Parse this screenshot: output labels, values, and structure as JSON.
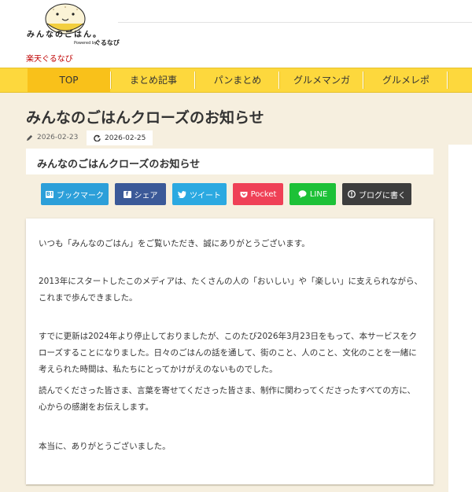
{
  "header": {
    "logo_text": "みんなのごはん。",
    "logo_powered": "Powered by",
    "logo_gnavi": "ぐるなび",
    "rakuten_link": "楽天ぐるなび"
  },
  "nav": {
    "items": [
      {
        "label": "TOP",
        "active": true
      },
      {
        "label": "まとめ記事"
      },
      {
        "label": "パンまとめ"
      },
      {
        "label": "グルメマンガ"
      },
      {
        "label": "グルメレポ"
      }
    ]
  },
  "article": {
    "title": "みんなのごはんクローズのお知らせ",
    "published_date": "2026-02-23",
    "updated_date": "2026-02-25",
    "subtitle": "みんなのごはんクローズのお知らせ",
    "paragraphs": [
      "いつも「みんなのごはん」をご覧いただき、誠にありがとうございます。",
      "2013年にスタートしたこのメディアは、たくさんの人の「おいしい」や「楽しい」に支えられながら、これまで歩んできました。",
      "すでに更新は2024年より停止しておりましたが、このたび2026年3月23日をもって、本サービスをクローズすることになりました。日々のごはんの話を通して、街のこと、人のこと、文化のことを一緒に考えられた時間は、私たちにとってかけがえのないものでした。",
      "読んでくださった皆さま、言葉を寄せてくださった皆さま、制作に関わってくださったすべての方に、心からの感謝をお伝えします。",
      "本当に、ありがとうございました。"
    ]
  },
  "share": {
    "hatena": {
      "label": "ブックマーク",
      "icon": "B!",
      "color": "#2c9fd9"
    },
    "facebook": {
      "label": "シェア",
      "icon": "f",
      "color": "#3b5998"
    },
    "twitter": {
      "label": "ツイート",
      "icon": "twitter-bird",
      "color": "#2ba9e1"
    },
    "pocket": {
      "label": "Pocket",
      "icon": "pocket-chevron",
      "color": "#ef4056"
    },
    "line": {
      "label": "LINE",
      "icon": "chat-bubble",
      "color": "#1dc137"
    },
    "blog": {
      "label": "ブログに書く",
      "icon": "hatena-blog",
      "color": "#3d3d3d"
    }
  },
  "colors": {
    "nav_bg": "#fdd83d",
    "nav_active": "#f9c11a",
    "page_bg": "#f6efdf"
  }
}
